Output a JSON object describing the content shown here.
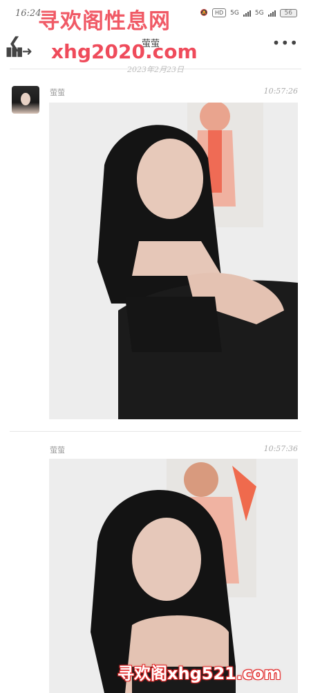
{
  "status_bar": {
    "time": "16:24",
    "indicators": [
      "HD",
      "5G",
      "5G"
    ],
    "battery": "56"
  },
  "watermarks": {
    "top_title": "寻欢阁性息网",
    "top_url": "xhg2020.com",
    "bottom": "寻欢阁xhg521.com"
  },
  "nav": {
    "title": "萤萤"
  },
  "chat": {
    "date": "2023年2月23日",
    "messages": [
      {
        "sender": "萤萤",
        "time": "10:57:26",
        "type": "image"
      },
      {
        "sender": "萤萤",
        "time": "10:57:36",
        "type": "image"
      }
    ]
  },
  "colors": {
    "watermark_red": "#ef4b5b",
    "background": "#ffffff"
  },
  "icons": [
    "back-icon",
    "more-icon",
    "mute-icon",
    "signal-icon",
    "battery-icon"
  ]
}
